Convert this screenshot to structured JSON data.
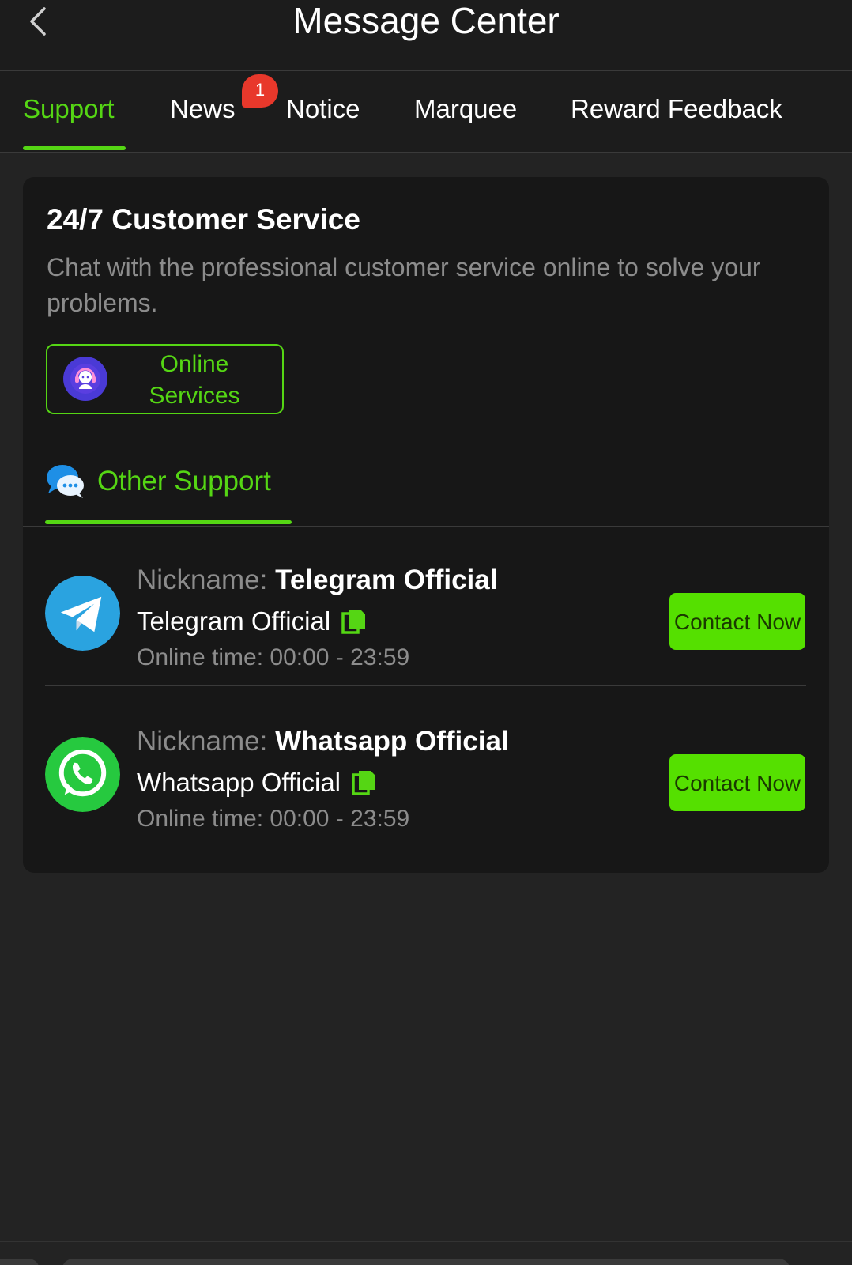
{
  "header": {
    "title": "Message Center",
    "back_icon": "chevron-left-icon"
  },
  "tabs": [
    {
      "label": "Support",
      "active": true
    },
    {
      "label": "News",
      "active": false,
      "badge": "1"
    },
    {
      "label": "Notice",
      "active": false
    },
    {
      "label": "Marquee",
      "active": false
    },
    {
      "label": "Reward Feedback",
      "active": false
    }
  ],
  "support": {
    "title": "24/7 Customer Service",
    "description": "Chat with the professional customer service online to solve your problems.",
    "online_button": {
      "label": "Online Services",
      "icon": "headset-agent-icon"
    },
    "other_support": {
      "label": "Other Support",
      "icon": "chat-bubbles-icon"
    },
    "contacts": [
      {
        "nickname_label": "Nickname:",
        "nickname": "Telegram Official",
        "account": "Telegram Official",
        "online_time": "Online time: 00:00 - 23:59",
        "button_label": "Contact Now",
        "icon": "telegram-icon"
      },
      {
        "nickname_label": "Nickname:",
        "nickname": "Whatsapp Official",
        "account": "Whatsapp Official",
        "online_time": "Online time: 00:00 - 23:59",
        "button_label": "Contact Now",
        "icon": "whatsapp-icon"
      }
    ]
  },
  "colors": {
    "accent": "#55d614",
    "button": "#55e000",
    "badge": "#e8382b",
    "background": "#232323",
    "card": "#171717"
  }
}
